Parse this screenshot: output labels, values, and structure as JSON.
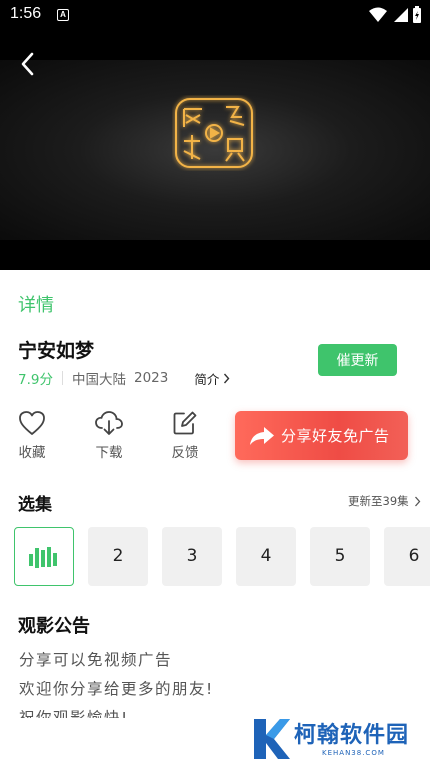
{
  "status_bar": {
    "time": "1:56",
    "notification_glyph": "A"
  },
  "player": {
    "logo_text": "网络视听"
  },
  "detail": {
    "section_label": "详情",
    "title": "宁安如梦",
    "score": "7.9分",
    "region": "中国大陆",
    "year": "2023",
    "intro_label": "简介",
    "urge_update_label": "催更新"
  },
  "actions": [
    {
      "label": "收藏",
      "icon": "heart-icon"
    },
    {
      "label": "下载",
      "icon": "cloud-download-icon"
    },
    {
      "label": "反馈",
      "icon": "edit-icon"
    }
  ],
  "share": {
    "label": "分享好友免广告",
    "icon": "share-arrow-icon"
  },
  "episodes": {
    "title": "选集",
    "update_text": "更新至39集",
    "items": [
      "",
      "2",
      "3",
      "4",
      "5",
      "6"
    ],
    "selected_index": 0
  },
  "notice": {
    "title": "观影公告",
    "lines": [
      "分享可以免视频广告",
      "欢迎你分享给更多的朋友!",
      "祝你观影愉快!"
    ]
  },
  "watermark": {
    "text": "柯翰软件园",
    "subtext": "KEHAN38.COM"
  },
  "colors": {
    "accent": "#3fc46c",
    "share_red": "#ef4c45",
    "watermark_blue": "#1e63b8"
  }
}
